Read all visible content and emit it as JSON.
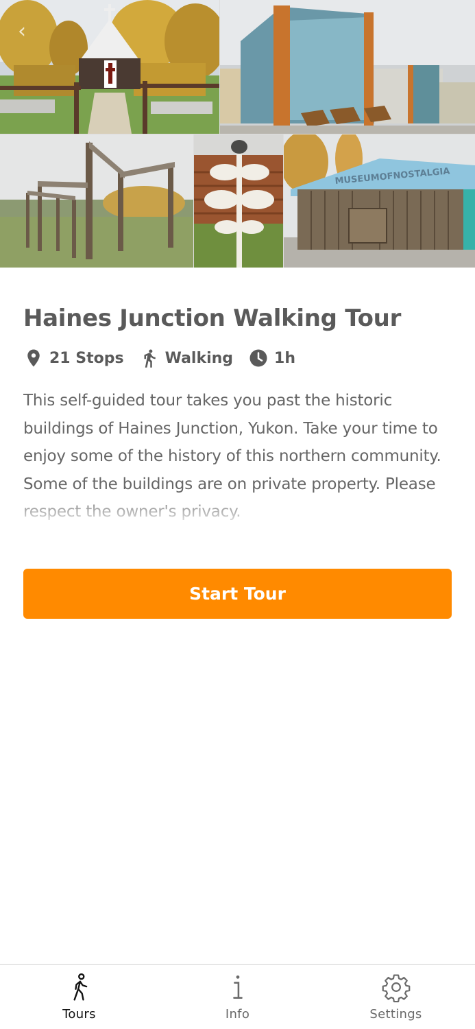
{
  "tour": {
    "title": "Haines Junction Walking Tour",
    "stops": "21 Stops",
    "mode": "Walking",
    "duration": "1h",
    "description": "This self-guided tour takes you past the historic buildings of Haines Junction, Yukon. Take your time to enjoy some of the history of this northern community. Some of the buildings are on private property. Please respect the owner's privacy."
  },
  "actions": {
    "start_label": "Start Tour"
  },
  "collage": {
    "museum_sign": "MUSEUMOFNOSTALGIA"
  },
  "nav": {
    "items": [
      {
        "label": "Tours",
        "icon": "walking-person-icon",
        "active": true
      },
      {
        "label": "Info",
        "icon": "info-icon",
        "active": false
      },
      {
        "label": "Settings",
        "icon": "gear-icon",
        "active": false
      }
    ]
  },
  "colors": {
    "accent": "#ff8a00",
    "text": "#5a5a5a",
    "nav_active": "#111111"
  }
}
